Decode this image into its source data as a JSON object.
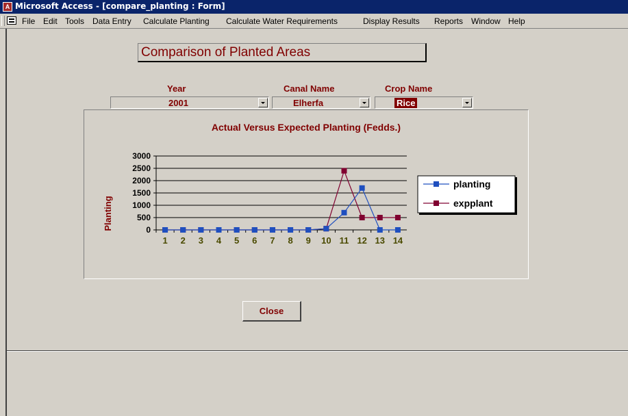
{
  "window": {
    "title": "Microsoft Access - [compare_planting : Form]"
  },
  "menu": [
    "File",
    "Edit",
    "Tools",
    "Data Entry",
    "Calculate Planting",
    "Calculate Water Requirements",
    "Display Results",
    "Reports",
    "Window",
    "Help"
  ],
  "form": {
    "title": "Comparison of Planted Areas",
    "year_label": "Year",
    "year_value": "2001",
    "canal_label": "Canal Name",
    "canal_value": "Elherfa",
    "crop_label": "Crop Name",
    "crop_value": "Rice",
    "close_label": "Close"
  },
  "colors": {
    "accent": "#800000",
    "planting": "#1f4fbf",
    "expplant": "#800030"
  },
  "chart_data": {
    "type": "line",
    "title": "Actual Versus Expected Planting (Fedds.)",
    "xlabel": "",
    "ylabel": "Planting",
    "categories": [
      "1",
      "2",
      "3",
      "4",
      "5",
      "6",
      "7",
      "8",
      "9",
      "10",
      "11",
      "12",
      "13",
      "14"
    ],
    "yticks": [
      "0",
      "500",
      "1000",
      "1500",
      "2000",
      "2500",
      "3000"
    ],
    "ylim": [
      0,
      3000
    ],
    "series": [
      {
        "name": "planting",
        "values": [
          0,
          0,
          0,
          0,
          0,
          0,
          0,
          0,
          0,
          50,
          700,
          1700,
          0,
          0
        ]
      },
      {
        "name": "expplant",
        "values": [
          0,
          0,
          0,
          0,
          0,
          0,
          0,
          0,
          0,
          50,
          2400,
          500,
          500,
          500
        ]
      }
    ],
    "legend": "right"
  }
}
